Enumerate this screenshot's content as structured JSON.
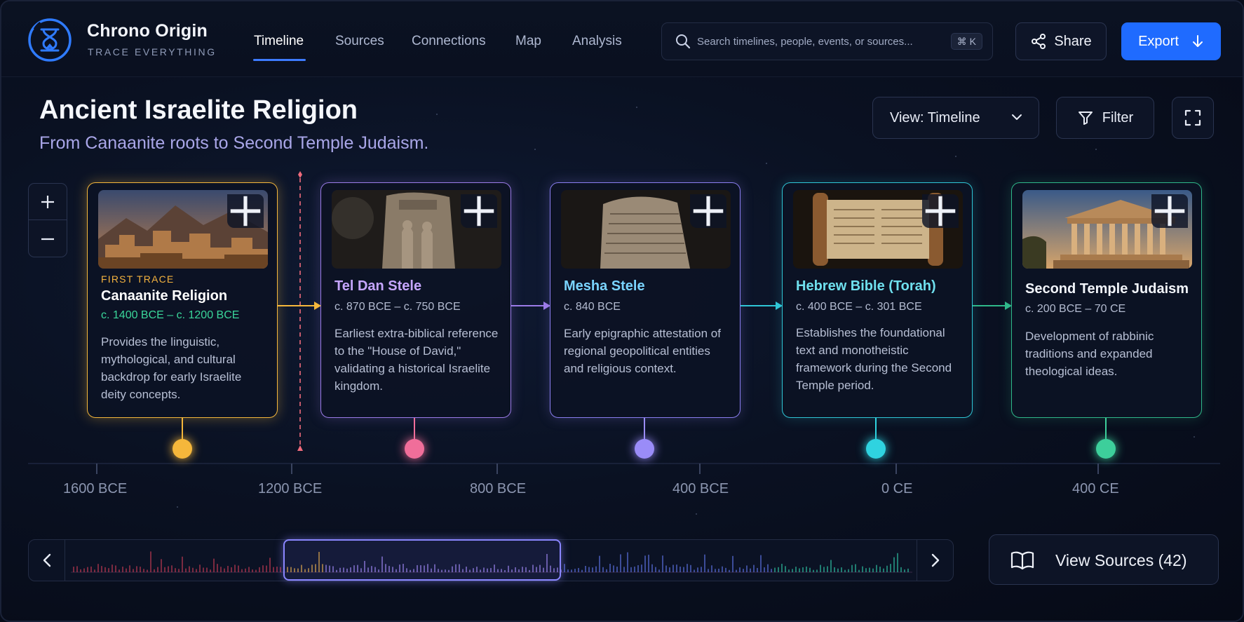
{
  "brand": {
    "name": "Chrono Origin",
    "tagline": "TRACE EVERYTHING"
  },
  "nav": [
    {
      "label": "Timeline",
      "active": true
    },
    {
      "label": "Sources",
      "active": false
    },
    {
      "label": "Connections",
      "active": false
    },
    {
      "label": "Map",
      "active": false
    },
    {
      "label": "Analysis",
      "active": false
    }
  ],
  "search": {
    "placeholder": "Search timelines, people, events, or sources...",
    "shortcut": "⌘ K"
  },
  "actions": {
    "share": "Share",
    "export": "Export"
  },
  "page": {
    "title": "Ancient Israelite Religion",
    "subtitle": "From Canaanite roots to Second Temple Judaism."
  },
  "toolbar": {
    "view": "View: Timeline",
    "filter": "Filter"
  },
  "icons": [
    "hourglass-logo-icon",
    "search-icon",
    "share-icon",
    "download-arrow-icon",
    "chevron-down-icon",
    "filter-icon",
    "fullscreen-icon",
    "plus-icon",
    "minus-icon",
    "chevron-left-icon",
    "chevron-right-icon",
    "book-icon"
  ],
  "colors": {
    "accent": "#1f6bff",
    "canaanite": "#f5b73b",
    "tel_dan": "#b28cf5",
    "mesha": "#9a8cf8",
    "torah": "#2fd3e0",
    "second_temple": "#3dcf9b",
    "marker": "#f0a0b8"
  },
  "events": [
    {
      "eyebrow": "FIRST TRACE",
      "title": "Canaanite Religion",
      "date": "c. 1400 BCE – c. 1200 BCE",
      "description": "Provides the linguistic, mythological, and cultural backdrop for early Israelite deity concepts.",
      "image": "canaanite-city-image"
    },
    {
      "title": "Tel Dan Stele",
      "date": "c. 870 BCE – c. 750 BCE",
      "description": "Earliest extra-biblical reference to the \"House of David,\" validating a historical Israelite kingdom.",
      "image": "tel-dan-stele-image"
    },
    {
      "title": "Mesha Stele",
      "date": "c. 840 BCE",
      "description": "Early epigraphic attestation of regional geopolitical entities and religious context.",
      "image": "mesha-stele-image"
    },
    {
      "title": "Hebrew Bible (Torah)",
      "date": "c. 400 BCE – c. 301 BCE",
      "description": "Establishes the foundational text and monotheistic framework during the Second Temple period.",
      "image": "torah-scroll-image"
    },
    {
      "title": "Second Temple Judaism",
      "date": "c. 200 BCE – 70 CE",
      "description": "Development of rabbinic traditions and expanded theological ideas.",
      "image": "temple-image"
    }
  ],
  "axis": [
    "1600 BCE",
    "1200 BCE",
    "800 BCE",
    "400 BCE",
    "0 CE",
    "400 CE"
  ],
  "sources": {
    "label": "View Sources (42)"
  }
}
